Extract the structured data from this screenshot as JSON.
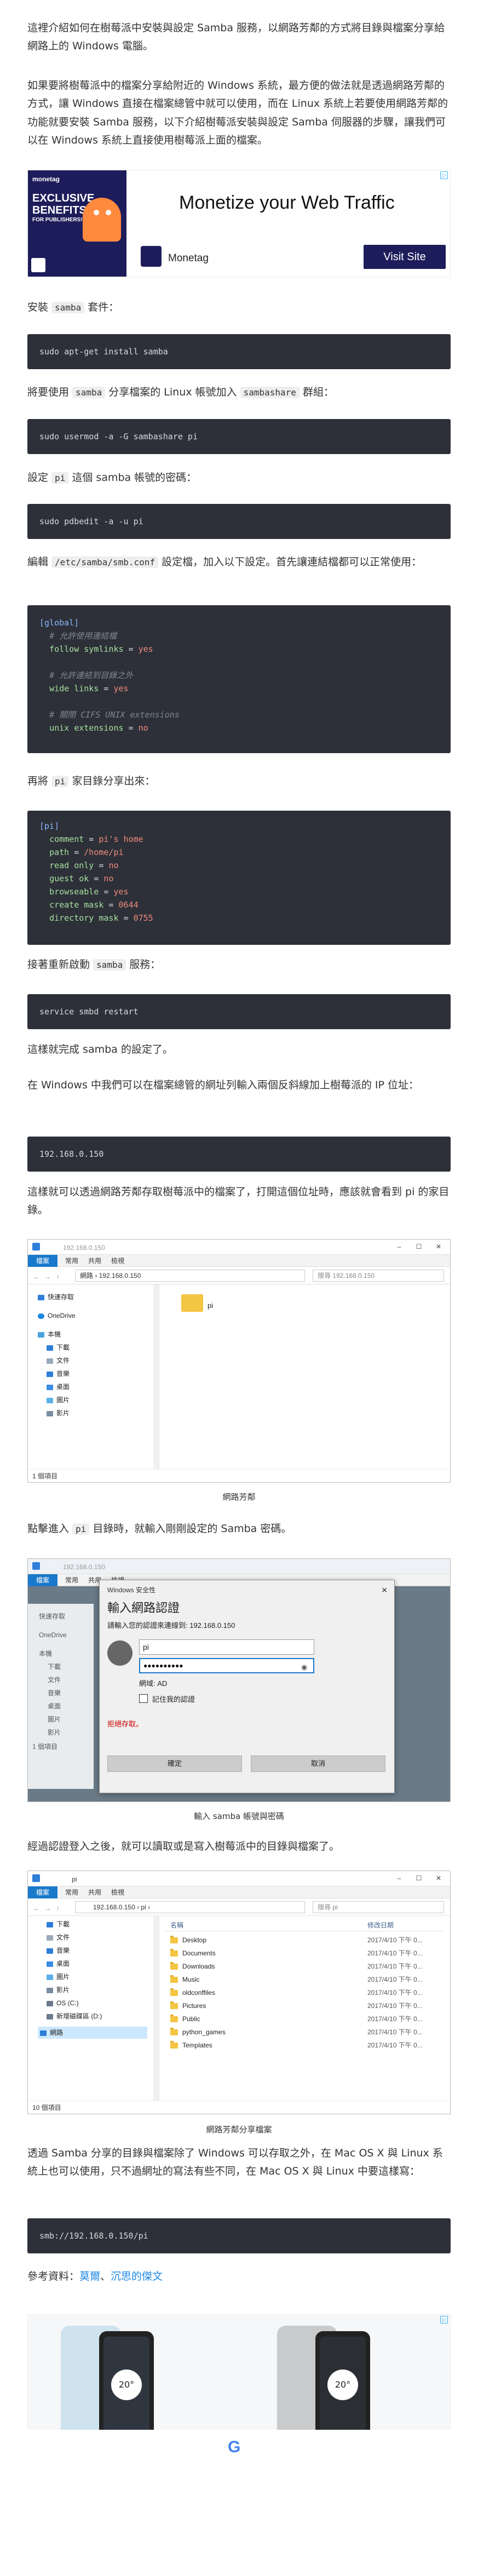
{
  "intro": {
    "p1": "這裡介紹如何在樹莓派中安裝與設定 Samba 服務，以網路芳鄰的方式將目錄與檔案分享給網路上的 Windows 電腦。",
    "p2": "如果要將樹莓派中的檔案分享給附近的 Windows 系統，最方便的做法就是透過網路芳鄰的方式，讓 Windows 直接在檔案總管中就可以使用，而在 Linux 系統上若要使用網路芳鄰的功能就要安裝 Samba 服務，以下介紹樹莓派安裝與設定 Samba 伺服器的步驟，讓我們可以在 Windows 系統上直接使用樹莓派上面的檔案。"
  },
  "ad1": {
    "logo_text": "monetag",
    "badge_line1": "EXCLUSIVE",
    "badge_line2": "BENEFITS",
    "badge_line3": "FOR PUBLISHERS!",
    "headline": "Monetize your Web Traffic",
    "brand": "Monetag",
    "cta": "Visit Site",
    "small_logo": "monetag"
  },
  "step_install": {
    "before": "安裝 ",
    "pkg": "samba",
    "after": " 套件："
  },
  "cmd_install": "sudo apt-get install samba",
  "step_group": {
    "before": "將要使用 ",
    "code1": "samba",
    "mid": " 分享檔案的 Linux 帳號加入 ",
    "code2": "sambashare",
    "after": " 群組："
  },
  "cmd_group": "sudo usermod -a -G sambashare pi",
  "step_pass": {
    "before": "設定 ",
    "code1": "pi",
    "after": " 這個 samba 帳號的密碼："
  },
  "cmd_pass": "sudo pdbedit -a -u pi",
  "step_edit": {
    "before": "編輯 ",
    "code1": "/etc/samba/smb.conf",
    "after": " 設定檔，加入以下設定。首先讓連結檔都可以正常使用："
  },
  "conf_global": {
    "section": "[global]",
    "c1": "# 允許使用連結檔",
    "k1": "follow symlinks",
    "v1": "yes",
    "c2": "# 允許連結到目錄之外",
    "k2": "wide links",
    "v2": "yes",
    "c3": "# 關閉 CIFS UNIX extensions",
    "k3": "unix extensions",
    "v3": "no"
  },
  "step_share": {
    "before": "再將 ",
    "code1": "pi",
    "after": " 家目錄分享出來："
  },
  "conf_pi": {
    "section": "[pi]",
    "l1k": "comment",
    "l1v": "pi's home",
    "l2k": "path",
    "l2v": "/home/pi",
    "l3k": "read only",
    "l3v": "no",
    "l4k": "guest ok",
    "l4v": "no",
    "l5k": "browseable",
    "l5v": "yes",
    "l6k": "create mask",
    "l6v": "0644",
    "l7k": "directory mask",
    "l7v": "0755"
  },
  "step_restart": {
    "before": "接著重新啟動 ",
    "code1": "samba",
    "after": " 服務："
  },
  "cmd_restart": "service smbd restart",
  "done_text": "這樣就完成 samba 的設定了。",
  "step_ip": "在 Windows 中我們可以在檔案總管的網址列輸入兩個反斜線加上樹莓派的 IP 位址：",
  "cmd_ip": "192.168.0.150",
  "step_see": "這樣就可以透過網路芳鄰存取樹莓派中的檔案了，打開這個位址時，應該就會看到 pi 的家目錄。",
  "shot1": {
    "title": "192.168.0.150",
    "tabs": [
      "檔案",
      "常用",
      "共用",
      "檢視"
    ],
    "address": "網路 › 192.168.0.150",
    "search": "搜尋 192.168.0.150",
    "nav": [
      "快速存取",
      "OneDrive",
      "本機",
      "下載",
      "文件",
      "音樂",
      "桌面",
      "圖片",
      "影片"
    ],
    "folder": "pi",
    "status": "1 個項目",
    "caption": "網路芳鄰"
  },
  "step_enter": {
    "before": "點擊進入 ",
    "code1": "pi",
    "after": " 目錄時，就輸入剛剛設定的 Samba 密碼。"
  },
  "shot2": {
    "bg_title": "192.168.0.150",
    "dialog_title": "Windows 安全性",
    "heading": "輸入網路認證",
    "prompt": "請輸入您的認證來連線到: 192.168.0.150",
    "user": "pi",
    "password": "●●●●●●●●●●",
    "domain": "網域: AD",
    "remember": "記住我的認證",
    "denied": "拒絕存取。",
    "ok": "確定",
    "cancel": "取消",
    "tabs": [
      "檔案",
      "常用",
      "共用",
      "檢視"
    ],
    "nav": [
      "快速存取",
      "OneDrive",
      "本機",
      "下載",
      "文件",
      "音樂",
      "桌面",
      "圖片",
      "影片"
    ],
    "status": "1 個項目",
    "caption": "輸入 samba 帳號與密碼"
  },
  "step_after": "經過認證登入之後，就可以讀取或是寫入樹莓派中的目錄與檔案了。",
  "shot3": {
    "title": "pi",
    "tabs": [
      "檔案",
      "常用",
      "共用",
      "檢視"
    ],
    "address": "192.168.0.150 › pi ›",
    "search": "搜尋 pi",
    "col_name": "名稱",
    "col_date": "修改日期",
    "nav": [
      "下載",
      "文件",
      "音樂",
      "桌面",
      "圖片",
      "影片",
      "OS (C:)",
      "新增磁碟區 (D:)",
      "網路"
    ],
    "files": [
      {
        "name": "Desktop",
        "date": "2017/4/10 下午 0..."
      },
      {
        "name": "Documents",
        "date": "2017/4/10 下午 0..."
      },
      {
        "name": "Downloads",
        "date": "2017/4/10 下午 0..."
      },
      {
        "name": "Music",
        "date": "2017/4/10 下午 0..."
      },
      {
        "name": "oldconffiles",
        "date": "2017/4/10 下午 0..."
      },
      {
        "name": "Pictures",
        "date": "2017/4/10 下午 0..."
      },
      {
        "name": "Public",
        "date": "2017/4/10 下午 0..."
      },
      {
        "name": "python_games",
        "date": "2017/4/10 下午 0..."
      },
      {
        "name": "Templates",
        "date": "2017/4/10 下午 0..."
      }
    ],
    "status": "10 個項目",
    "caption": "網路芳鄰分享檔案"
  },
  "step_mac": "透過 Samba 分享的目錄與檔案除了 Windows 可以存取之外，在 Mac OS X 與 Linux 系統上也可以使用，只不過網址的寫法有些不同，在 Mac OS X 與 Linux 中要這樣寫：",
  "cmd_mac": "smb://192.168.0.150/pi",
  "refs": {
    "label": "參考資料：",
    "link1": "莫爾",
    "sep": "、",
    "link2": "沉思的傑文"
  },
  "ad2": {
    "brand": "Google",
    "time": "20°"
  },
  "colors": {
    "code_bg": "#2d3038",
    "link": "#1e88e5",
    "accent_blue": "#1979ca",
    "ad_navy": "#1d1d5b"
  }
}
